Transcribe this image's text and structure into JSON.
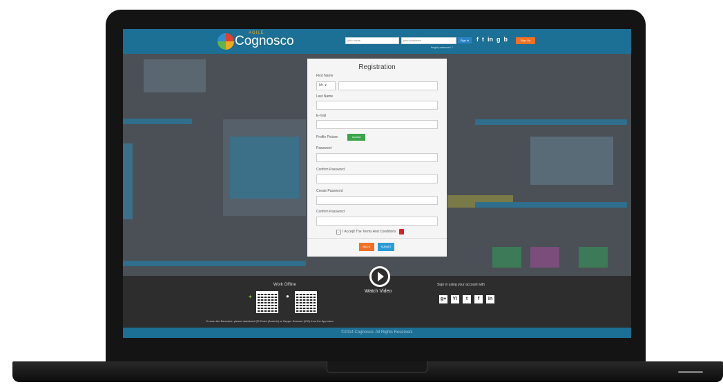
{
  "header": {
    "logo_agile": "AGILE",
    "logo_name": "Cognosco",
    "username_placeholder": "your name",
    "password_placeholder": "your password",
    "signin_label": "Sign in",
    "forgot_label": "forgot password ?",
    "signup_label": "Sign Up",
    "social": [
      "f",
      "t",
      "in",
      "g",
      "b"
    ]
  },
  "registration": {
    "title": "Registration",
    "first_name_label": "First Name",
    "title_select": "Mr. ▾",
    "last_name_label": "Last Name",
    "email_label": "E-mail",
    "profile_picture_label": "Profile Picture",
    "upload_label": "Upload",
    "password_label": "Password",
    "confirm_password_label": "Confirm Password",
    "create_password_label": "Create Password",
    "confirm_password2_label": "Confirm Password",
    "terms_label": "I Accept The Terms And Conditions",
    "back_label": "BACK",
    "submit_label": "SUBMIT"
  },
  "footer": {
    "work_offline": "Work Offline",
    "watch_video": "Watch Video",
    "signin_with": "Sign in using your account with",
    "barcode_note": "To scan the Barcodes, please download QR Droid (Android) or Zapper Scanner (iOS) from the App store.",
    "social_icons": [
      "g+",
      "Y!",
      "t",
      "f",
      "in"
    ],
    "copyright": "©2014 Cognosco. All Rights Reserved."
  },
  "colors": {
    "brand_blue": "#1c6f95",
    "accent_orange": "#f07026",
    "upload_green": "#3aa548",
    "submit_blue": "#2b9bd8"
  }
}
